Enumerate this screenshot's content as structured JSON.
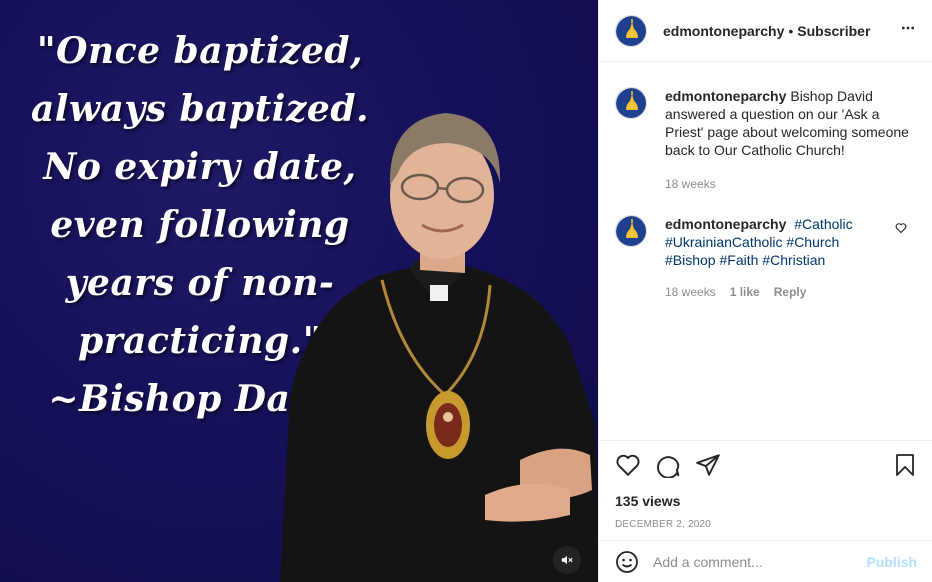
{
  "post": {
    "quote_lines": [
      "\"Once baptized,",
      "always baptized.",
      "No expiry date,",
      "even following",
      "years of non-",
      "practicing.\"",
      "~Bishop David"
    ]
  },
  "header": {
    "username": "edmontoneparchy",
    "separator": "•",
    "subscriber_label": "Subscriber"
  },
  "caption": {
    "username": "edmontoneparchy",
    "text": "Bishop David answered a question on our 'Ask a Priest' page about welcoming someone back to Our Catholic Church!",
    "time": "18 weeks"
  },
  "comment": {
    "username": "edmontoneparchy",
    "tags": [
      "#Catholic",
      "#UkrainianCatholic",
      "#Church",
      "#Bishop",
      "#Faith",
      "#Christian"
    ],
    "time": "18 weeks",
    "likes": "1 like",
    "reply_label": "Reply"
  },
  "stats": {
    "views": "135 views",
    "date": "DECEMBER 2, 2020"
  },
  "add_comment": {
    "placeholder": "Add a comment...",
    "publish_label": "Publish"
  },
  "colors": {
    "background_media": "#15115a",
    "link": "#00376b",
    "publish_disabled": "#b2dffc",
    "avatar_blue": "#1f3f8f",
    "avatar_gold": "#f2c230"
  }
}
